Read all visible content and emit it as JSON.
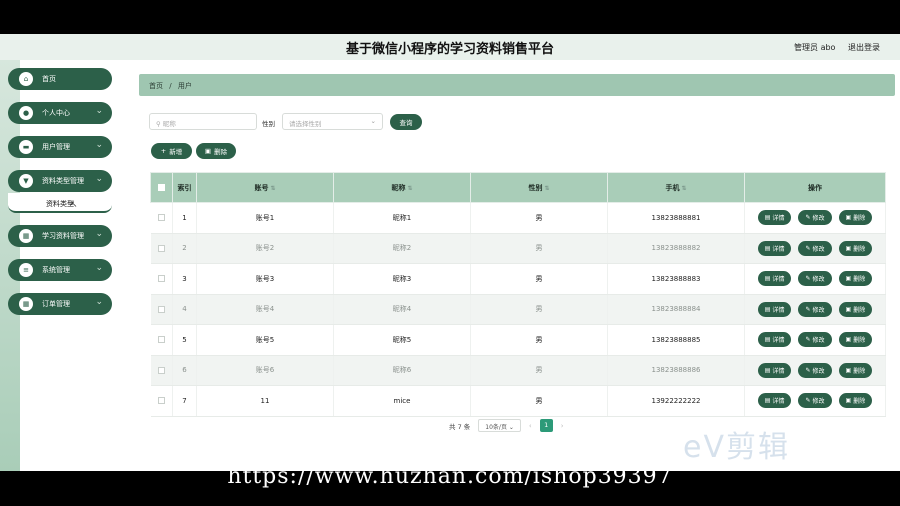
{
  "header": {
    "title": "基于微信小程序的学习资料销售平台",
    "user_label": "管理员 abo",
    "logout_label": "退出登录"
  },
  "sidebar": {
    "items": [
      {
        "label": "首页",
        "icon": "home-icon",
        "glyph": "⌂",
        "has_children": false
      },
      {
        "label": "个人中心",
        "icon": "user-icon",
        "glyph": "●",
        "has_children": true
      },
      {
        "label": "用户管理",
        "icon": "users-icon",
        "glyph": "▬",
        "has_children": true
      },
      {
        "label": "资料类型管理",
        "icon": "category-icon",
        "glyph": "▼",
        "has_children": true,
        "expanded": true,
        "children": [
          "资料类型"
        ]
      },
      {
        "label": "学习资料管理",
        "icon": "grid-icon",
        "glyph": "▦",
        "has_children": true
      },
      {
        "label": "系统管理",
        "icon": "menu-icon",
        "glyph": "≡",
        "has_children": true
      },
      {
        "label": "订单管理",
        "icon": "order-icon",
        "glyph": "▦",
        "has_children": true
      }
    ]
  },
  "breadcrumb": [
    "首页",
    "/",
    "用户"
  ],
  "filters": {
    "nickname_placeholder": "昵称",
    "gender_label": "性别",
    "gender_placeholder": "请选择性别",
    "search_label": "查询",
    "add_label": "新增",
    "delete_label": "删除"
  },
  "table": {
    "columns": [
      "索引",
      "账号",
      "昵称",
      "性别",
      "手机",
      "操作"
    ],
    "rows": [
      {
        "index": "1",
        "account": "账号1",
        "nickname": "昵称1",
        "gender": "男",
        "phone": "13823888881"
      },
      {
        "index": "2",
        "account": "账号2",
        "nickname": "昵称2",
        "gender": "男",
        "phone": "13823888882"
      },
      {
        "index": "3",
        "account": "账号3",
        "nickname": "昵称3",
        "gender": "男",
        "phone": "13823888883"
      },
      {
        "index": "4",
        "account": "账号4",
        "nickname": "昵称4",
        "gender": "男",
        "phone": "13823888884"
      },
      {
        "index": "5",
        "account": "账号5",
        "nickname": "昵称5",
        "gender": "男",
        "phone": "13823888885"
      },
      {
        "index": "6",
        "account": "账号6",
        "nickname": "昵称6",
        "gender": "男",
        "phone": "13823888886"
      },
      {
        "index": "7",
        "account": "11",
        "nickname": "mice",
        "gender": "男",
        "phone": "13922222222"
      }
    ],
    "actions": {
      "detail": "详情",
      "edit": "修改",
      "delete": "删除"
    }
  },
  "pagination": {
    "total_label": "共 7 条",
    "page_size": "10条/页",
    "current_page": "1"
  },
  "watermark": "eV剪辑",
  "caption": "https://www.huzhan.com/ishop39397",
  "colors": {
    "primary": "#2c6049",
    "header_row": "#a9cdb8",
    "breadcrumb": "#9fc6b1"
  }
}
